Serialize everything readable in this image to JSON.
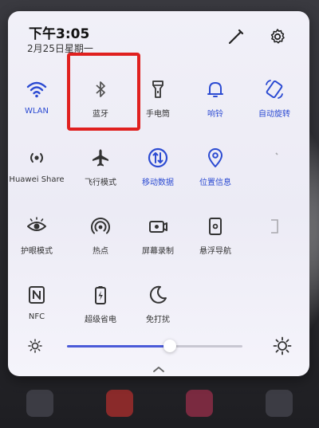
{
  "status": {
    "time": "下午3:05",
    "date": "2月25日星期一"
  },
  "tiles": [
    {
      "id": "wlan",
      "label": "WLAN",
      "icon": "wifi-icon",
      "on": true
    },
    {
      "id": "bluetooth",
      "label": "蓝牙",
      "icon": "bluetooth-icon",
      "on": false
    },
    {
      "id": "flashlight",
      "label": "手电筒",
      "icon": "flashlight-icon",
      "on": false
    },
    {
      "id": "ringtone",
      "label": "响铃",
      "icon": "bell-icon",
      "on": true
    },
    {
      "id": "autorotate",
      "label": "自动旋转",
      "icon": "rotate-icon",
      "on": true
    },
    {
      "id": "huawei-share",
      "label": "Huawei Share",
      "icon": "share-icon",
      "on": false
    },
    {
      "id": "airplane",
      "label": "飞行模式",
      "icon": "airplane-icon",
      "on": false
    },
    {
      "id": "mobile-data",
      "label": "移动数据",
      "icon": "mobile-data-icon",
      "on": true
    },
    {
      "id": "location",
      "label": "位置信息",
      "icon": "location-icon",
      "on": true
    },
    {
      "id": "hotspot-more",
      "label": "",
      "icon": "more-icon",
      "on": false
    },
    {
      "id": "eye-comfort",
      "label": "护眼模式",
      "icon": "eye-icon",
      "on": false
    },
    {
      "id": "hotspot",
      "label": "热点",
      "icon": "hotspot-icon",
      "on": false
    },
    {
      "id": "screen-record",
      "label": "屏幕录制",
      "icon": "record-icon",
      "on": false
    },
    {
      "id": "screenshot",
      "label": "悬浮导航",
      "icon": "screenshot-icon",
      "on": false
    },
    {
      "id": "misc",
      "label": "",
      "icon": "misc-icon",
      "on": false
    },
    {
      "id": "nfc",
      "label": "NFC",
      "icon": "nfc-icon",
      "on": false
    },
    {
      "id": "power-saving",
      "label": "超级省电",
      "icon": "battery-icon",
      "on": false
    },
    {
      "id": "dnd",
      "label": "免打扰",
      "icon": "moon-icon",
      "on": false
    }
  ],
  "brightness": {
    "level": 0.65
  },
  "dock": [
    {
      "label": ""
    },
    {
      "label": ""
    },
    {
      "label": ""
    },
    {
      "label": ""
    }
  ],
  "colors": {
    "accent": "#2c4bd2",
    "highlight": "#e0201f",
    "panel": "#efeef7"
  }
}
